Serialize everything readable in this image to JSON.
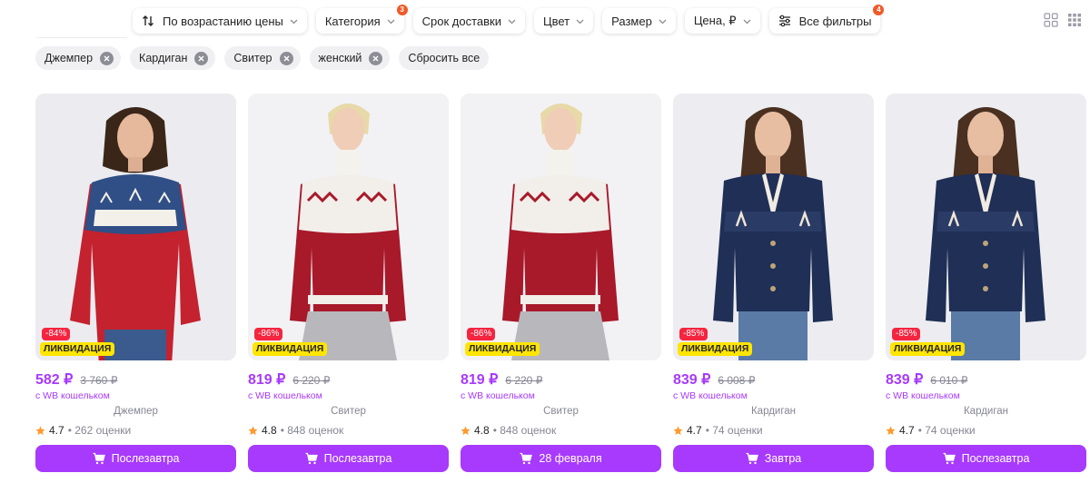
{
  "filters": {
    "sort": {
      "label": "По возрастанию цены",
      "icon": "sort-arrows-icon"
    },
    "category": {
      "label": "Категория",
      "badge": "3"
    },
    "delivery": {
      "label": "Срок доставки"
    },
    "color": {
      "label": "Цвет"
    },
    "size": {
      "label": "Размер"
    },
    "price": {
      "label": "Цена, ₽"
    },
    "all": {
      "label": "Все фильтры",
      "badge": "4",
      "icon": "sliders-icon"
    }
  },
  "view_toggles": [
    "grid-small-icon",
    "grid-large-icon"
  ],
  "chips": [
    {
      "label": "Джемпер"
    },
    {
      "label": "Кардиган"
    },
    {
      "label": "Свитер"
    },
    {
      "label": "женский"
    }
  ],
  "reset_label": "Сбросить все",
  "colors": {
    "accent": "#a73afd",
    "discount": "#f5243f",
    "liquidation": "#ffe500",
    "badge": "#f05a28",
    "star": "#ff9a2e"
  },
  "products": [
    {
      "discount": "-84%",
      "tag": "ЛИКВИДАЦИЯ",
      "price": "582 ₽",
      "old_price": "3 760 ₽",
      "wallet": "с WB кошельком",
      "name": "Джемпер",
      "rating": "4.7",
      "reviews": "• 262 оценки",
      "delivery": "Послезавтра"
    },
    {
      "discount": "-86%",
      "tag": "ЛИКВИДАЦИЯ",
      "price": "819 ₽",
      "old_price": "6 220 ₽",
      "wallet": "с WB кошельком",
      "name": "Свитер",
      "rating": "4.8",
      "reviews": "• 848 оценок",
      "delivery": "Послезавтра"
    },
    {
      "discount": "-86%",
      "tag": "ЛИКВИДАЦИЯ",
      "price": "819 ₽",
      "old_price": "6 220 ₽",
      "wallet": "с WB кошельком",
      "name": "Свитер",
      "rating": "4.8",
      "reviews": "• 848 оценок",
      "delivery": "28 февраля"
    },
    {
      "discount": "-85%",
      "tag": "ЛИКВИДАЦИЯ",
      "price": "839 ₽",
      "old_price": "6 008 ₽",
      "wallet": "с WB кошельком",
      "name": "Кардиган",
      "rating": "4.7",
      "reviews": "• 74 оценки",
      "delivery": "Завтра"
    },
    {
      "discount": "-85%",
      "tag": "ЛИКВИДАЦИЯ",
      "price": "839 ₽",
      "old_price": "6 010 ₽",
      "wallet": "с WB кошельком",
      "name": "Кардиган",
      "rating": "4.7",
      "reviews": "• 74 оценки",
      "delivery": "Послезавтра"
    }
  ]
}
